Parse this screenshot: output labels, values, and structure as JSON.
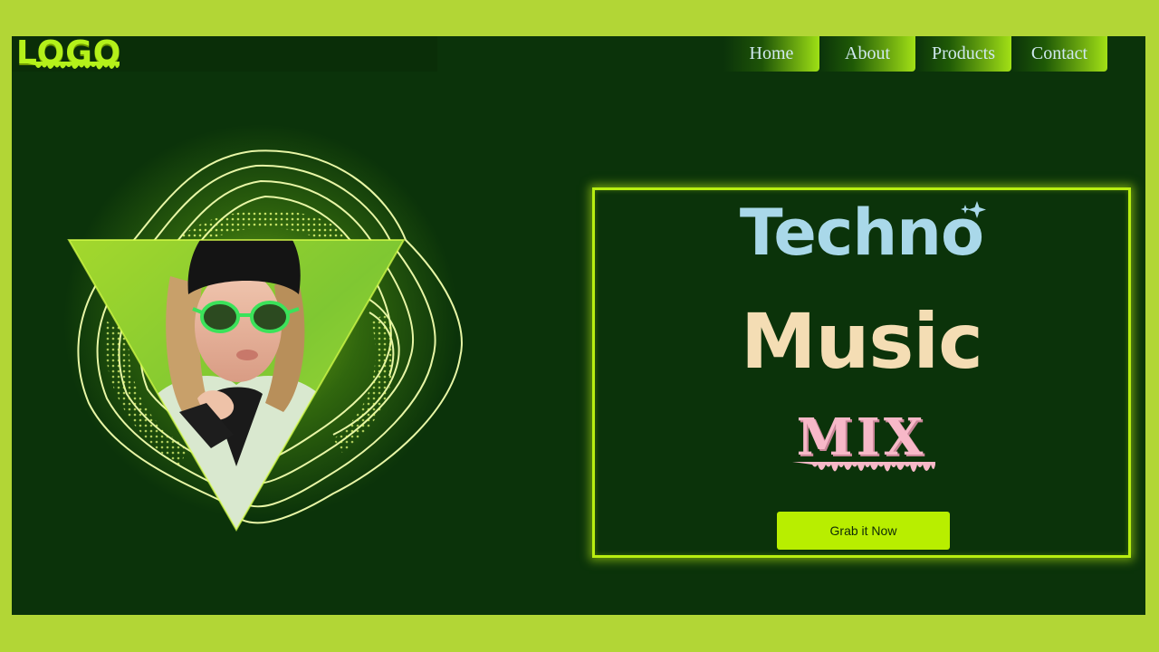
{
  "header": {
    "logo_text": "LOGO"
  },
  "nav": {
    "items": [
      {
        "label": "Home"
      },
      {
        "label": "About"
      },
      {
        "label": "Products"
      },
      {
        "label": "Contact"
      }
    ]
  },
  "hero": {
    "title_line1": "Techno",
    "title_line2": "Music",
    "title_line3": "MIX",
    "cta_label": "Grab it Now"
  },
  "colors": {
    "outer_background": "#b2d636",
    "page_background": "#0b330a",
    "accent": "#b8ee11",
    "techno_text": "#a9d8e9",
    "music_text": "#f4ddb4",
    "mix_text": "#f7b8c8"
  },
  "icons": {
    "sparkle": "sparkle-icon"
  }
}
